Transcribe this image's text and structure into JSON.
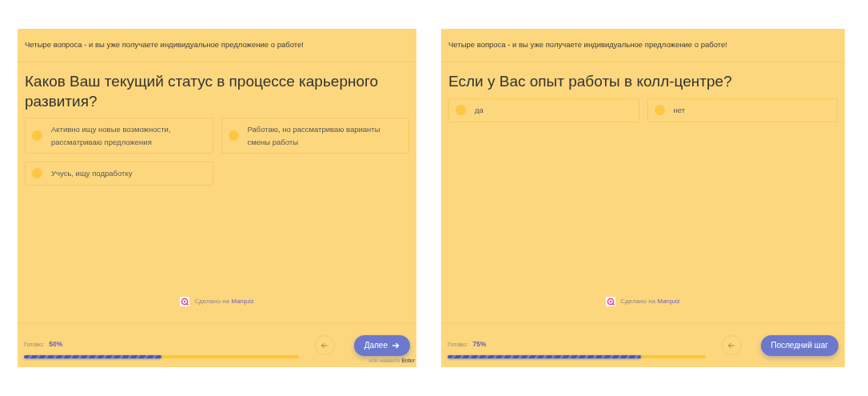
{
  "panels": [
    {
      "header": "Четыре вопроса - и вы уже получаете индивидуальное предложение о работе!",
      "question": "Каков Ваш текущий статус в процессе карьерного развития?",
      "options": [
        {
          "label": "Активно ищу новые возможности, рассматриваю предложения",
          "selected": false
        },
        {
          "label": "Работаю, но рассматриваю варианты смены работы",
          "selected": false
        },
        {
          "label": "Учусь, ищу подработку",
          "selected": false
        }
      ],
      "credit": {
        "text": "Сделано на",
        "link": "Marquiz"
      },
      "progress": {
        "label": "Готово:",
        "value": "50%",
        "level": 0.5
      },
      "next_button": {
        "label": "Далее",
        "arrow": true
      },
      "hint": "или нажмите **Enter**"
    },
    {
      "header": "Четыре вопроса - и вы уже получаете индивидуальное предложение о работе!",
      "question": "Если у Вас опыт работы в колл-центре?",
      "options": [
        {
          "label": "да",
          "selected": false
        },
        {
          "label": "нет",
          "selected": false
        }
      ],
      "credit": {
        "text": "Сделано на",
        "link": "Marquiz"
      },
      "progress": {
        "label": "Готово:",
        "value": "75%",
        "level": 0.75
      },
      "next_button": {
        "label": "Последний шаг",
        "arrow": false
      }
    }
  ]
}
